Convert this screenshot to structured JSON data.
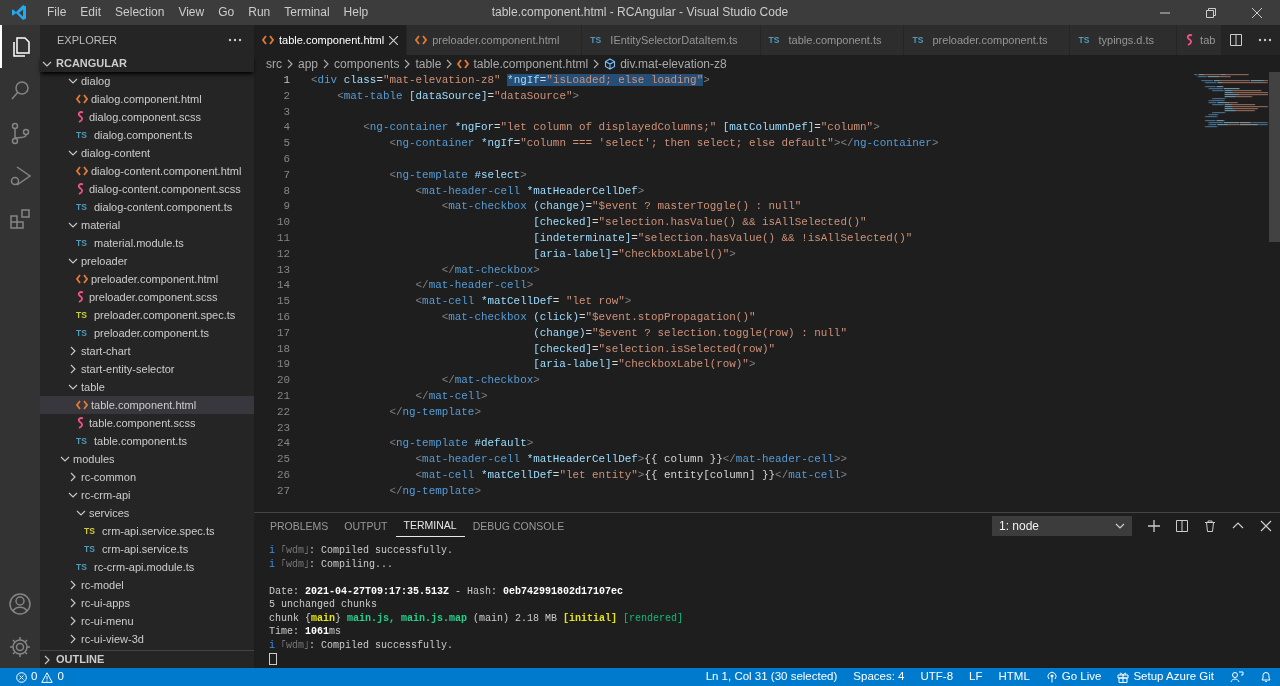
{
  "window": {
    "title": "table.component.html - RCAngular - Visual Studio Code"
  },
  "menu": [
    "File",
    "Edit",
    "Selection",
    "View",
    "Go",
    "Run",
    "Terminal",
    "Help"
  ],
  "explorer": {
    "title": "EXPLORER",
    "root": "RCANGULAR",
    "root_expanded": true,
    "outline": "OUTLINE",
    "outline_expanded": false,
    "tree_top": [
      {
        "name": "dialog",
        "kind": "folder",
        "expanded": true,
        "selected": false,
        "children": [
          {
            "name": "dialog.component.html",
            "kind": "html",
            "selected": false
          },
          {
            "name": "dialog.component.scss",
            "kind": "scss",
            "selected": false
          },
          {
            "name": "dialog.component.ts",
            "kind": "ts",
            "badge": "TS",
            "selected": false
          }
        ]
      },
      {
        "name": "dialog-content",
        "kind": "folder",
        "expanded": true,
        "selected": false,
        "children": [
          {
            "name": "dialog-content.component.html",
            "kind": "html",
            "selected": false
          },
          {
            "name": "dialog-content.component.scss",
            "kind": "scss",
            "selected": false
          },
          {
            "name": "dialog-content.component.ts",
            "kind": "ts",
            "badge": "TS",
            "selected": false
          }
        ]
      },
      {
        "name": "material",
        "kind": "folder",
        "expanded": true,
        "selected": false,
        "children": [
          {
            "name": "material.module.ts",
            "kind": "ts",
            "badge": "TS",
            "selected": false
          }
        ]
      },
      {
        "name": "preloader",
        "kind": "folder",
        "expanded": true,
        "selected": false,
        "children": [
          {
            "name": "preloader.component.html",
            "kind": "html",
            "selected": false
          },
          {
            "name": "preloader.component.scss",
            "kind": "scss",
            "selected": false
          },
          {
            "name": "preloader.component.spec.ts",
            "kind": "spec",
            "badge": "TS",
            "selected": false
          },
          {
            "name": "preloader.component.ts",
            "kind": "ts",
            "badge": "TS",
            "selected": false
          }
        ]
      },
      {
        "name": "start-chart",
        "kind": "folder",
        "expanded": false,
        "selected": false
      },
      {
        "name": "start-entity-selector",
        "kind": "folder",
        "expanded": false,
        "selected": false
      },
      {
        "name": "table",
        "kind": "folder",
        "expanded": true,
        "selected": false,
        "children": [
          {
            "name": "table.component.html",
            "kind": "html",
            "selected": true
          },
          {
            "name": "table.component.scss",
            "kind": "scss",
            "selected": false
          },
          {
            "name": "table.component.ts",
            "kind": "ts",
            "badge": "TS",
            "selected": false
          }
        ]
      }
    ],
    "tree": [
      {
        "name": "modules",
        "kind": "folder",
        "expanded": true,
        "selected": false,
        "children": [
          {
            "name": "rc-common",
            "kind": "folder",
            "expanded": false,
            "selected": false
          },
          {
            "name": "rc-crm-api",
            "kind": "folder",
            "expanded": true,
            "selected": false,
            "children": [
              {
                "name": "services",
                "kind": "folder",
                "expanded": true,
                "selected": false,
                "children": [
                  {
                    "name": "crm-api.service.spec.ts",
                    "kind": "spec",
                    "badge": "TS",
                    "selected": false
                  },
                  {
                    "name": "crm-api.service.ts",
                    "kind": "ts",
                    "badge": "TS",
                    "selected": false
                  }
                ]
              },
              {
                "name": "rc-crm-api.module.ts",
                "kind": "ts",
                "badge": "TS",
                "selected": false
              }
            ]
          },
          {
            "name": "rc-model",
            "kind": "folder",
            "expanded": false,
            "selected": false
          },
          {
            "name": "rc-ui-apps",
            "kind": "folder",
            "expanded": false,
            "selected": false
          },
          {
            "name": "rc-ui-menu",
            "kind": "folder",
            "expanded": false,
            "selected": false
          },
          {
            "name": "rc-ui-view-3d",
            "kind": "folder",
            "expanded": false,
            "selected": false
          }
        ]
      }
    ]
  },
  "tabs": [
    {
      "label": "table.component.html",
      "kind": "html",
      "selected": true
    },
    {
      "label": "preloader.component.html",
      "kind": "html",
      "selected": false
    },
    {
      "label": "IEntitySelectorDataItem.ts",
      "kind": "ts",
      "badge": "TS",
      "selected": false
    },
    {
      "label": "table.component.ts",
      "kind": "ts",
      "badge": "TS",
      "selected": false
    },
    {
      "label": "preloader.component.ts",
      "kind": "ts",
      "badge": "TS",
      "selected": false
    },
    {
      "label": "typings.d.ts",
      "kind": "ts",
      "badge": "TS",
      "selected": false
    },
    {
      "label": "tab",
      "kind": "scss",
      "selected": false
    }
  ],
  "breadcrumbs": [
    {
      "text": "src",
      "kind": "folder"
    },
    {
      "text": "app",
      "kind": "folder"
    },
    {
      "text": "components",
      "kind": "folder"
    },
    {
      "text": "table",
      "kind": "folder"
    },
    {
      "text": "table.component.html",
      "kind": "html"
    },
    {
      "text": "div.mat-elevation-z8",
      "kind": "element"
    }
  ],
  "code": [
    {
      "number": "1",
      "tokens": [
        {
          "kind": "bracket",
          "text": "<"
        },
        {
          "kind": "tag",
          "text": "div"
        },
        {
          "kind": "attr",
          "text": " class"
        },
        {
          "kind": "plain",
          "text": "="
        },
        {
          "kind": "value",
          "text": "\"mat-elevation-z8\" "
        },
        {
          "kind": "attr",
          "text": "*ngIf",
          "selected": true
        },
        {
          "kind": "plain",
          "text": "=",
          "selected": true
        },
        {
          "kind": "value",
          "text": "\"isLoaded; else loading\"",
          "selected": true
        },
        {
          "kind": "bracket",
          "text": ">"
        }
      ]
    },
    {
      "number": "2",
      "tokens": [
        {
          "kind": "bracket",
          "text": "    <"
        },
        {
          "kind": "tag",
          "text": "mat-table"
        },
        {
          "kind": "attr",
          "text": " [dataSource]"
        },
        {
          "kind": "plain",
          "text": "="
        },
        {
          "kind": "value",
          "text": "\"dataSource\""
        },
        {
          "kind": "bracket",
          "text": ">"
        }
      ]
    },
    {
      "number": "3"
    },
    {
      "number": "4",
      "tokens": [
        {
          "kind": "bracket",
          "text": "        <"
        },
        {
          "kind": "tag",
          "text": "ng-container"
        },
        {
          "kind": "attr",
          "text": " *ngFor"
        },
        {
          "kind": "plain",
          "text": "="
        },
        {
          "kind": "value",
          "text": "\"let column of displayedColumns;\""
        },
        {
          "kind": "attr",
          "text": " [matColumnDef]"
        },
        {
          "kind": "plain",
          "text": "="
        },
        {
          "kind": "value",
          "text": "\"column\""
        },
        {
          "kind": "bracket",
          "text": ">"
        }
      ]
    },
    {
      "number": "5",
      "tokens": [
        {
          "kind": "bracket",
          "text": "            <"
        },
        {
          "kind": "tag",
          "text": "ng-container"
        },
        {
          "kind": "attr",
          "text": " *ngIf"
        },
        {
          "kind": "plain",
          "text": "="
        },
        {
          "kind": "value",
          "text": "\"column === 'select'; then select; else default\""
        },
        {
          "kind": "bracket",
          "text": "></"
        },
        {
          "kind": "tag",
          "text": "ng-container"
        },
        {
          "kind": "bracket",
          "text": ">"
        }
      ]
    },
    {
      "number": "6"
    },
    {
      "number": "7",
      "tokens": [
        {
          "kind": "bracket",
          "text": "            <"
        },
        {
          "kind": "tag",
          "text": "ng-template"
        },
        {
          "kind": "attr",
          "text": " #select"
        },
        {
          "kind": "bracket",
          "text": ">"
        }
      ]
    },
    {
      "number": "8",
      "tokens": [
        {
          "kind": "bracket",
          "text": "                <"
        },
        {
          "kind": "tag",
          "text": "mat-header-cell"
        },
        {
          "kind": "attr",
          "text": " *matHeaderCellDef"
        },
        {
          "kind": "bracket",
          "text": ">"
        }
      ]
    },
    {
      "number": "9",
      "tokens": [
        {
          "kind": "bracket",
          "text": "                    <"
        },
        {
          "kind": "tag",
          "text": "mat-checkbox"
        },
        {
          "kind": "attr",
          "text": " (change)"
        },
        {
          "kind": "plain",
          "text": "="
        },
        {
          "kind": "value",
          "text": "\"$event ? masterToggle() : null\""
        }
      ]
    },
    {
      "number": "10",
      "tokens": [
        {
          "kind": "attr",
          "text": "                                  [checked]"
        },
        {
          "kind": "plain",
          "text": "="
        },
        {
          "kind": "value",
          "text": "\"selection.hasValue() && isAllSelected()\""
        }
      ]
    },
    {
      "number": "11",
      "tokens": [
        {
          "kind": "attr",
          "text": "                                  [indeterminate]"
        },
        {
          "kind": "plain",
          "text": "="
        },
        {
          "kind": "value",
          "text": "\"selection.hasValue() && !isAllSelected()\""
        }
      ]
    },
    {
      "number": "12",
      "tokens": [
        {
          "kind": "attr",
          "text": "                                  [aria-label]"
        },
        {
          "kind": "plain",
          "text": "="
        },
        {
          "kind": "value",
          "text": "\"checkboxLabel()\""
        },
        {
          "kind": "bracket",
          "text": ">"
        }
      ]
    },
    {
      "number": "13",
      "tokens": [
        {
          "kind": "bracket",
          "text": "                    </"
        },
        {
          "kind": "tag",
          "text": "mat-checkbox"
        },
        {
          "kind": "bracket",
          "text": ">"
        }
      ]
    },
    {
      "number": "14",
      "tokens": [
        {
          "kind": "bracket",
          "text": "                </"
        },
        {
          "kind": "tag",
          "text": "mat-header-cell"
        },
        {
          "kind": "bracket",
          "text": ">"
        }
      ]
    },
    {
      "number": "15",
      "tokens": [
        {
          "kind": "bracket",
          "text": "                <"
        },
        {
          "kind": "tag",
          "text": "mat-cell"
        },
        {
          "kind": "attr",
          "text": " *matCellDef"
        },
        {
          "kind": "plain",
          "text": "= "
        },
        {
          "kind": "value",
          "text": "\"let row\""
        },
        {
          "kind": "bracket",
          "text": ">"
        }
      ]
    },
    {
      "number": "16",
      "tokens": [
        {
          "kind": "bracket",
          "text": "                    <"
        },
        {
          "kind": "tag",
          "text": "mat-checkbox"
        },
        {
          "kind": "attr",
          "text": " (click)"
        },
        {
          "kind": "plain",
          "text": "="
        },
        {
          "kind": "value",
          "text": "\"$event.stopPropagation()\""
        }
      ]
    },
    {
      "number": "17",
      "tokens": [
        {
          "kind": "attr",
          "text": "                                  (change)"
        },
        {
          "kind": "plain",
          "text": "="
        },
        {
          "kind": "value",
          "text": "\"$event ? selection.toggle(row) : null\""
        }
      ]
    },
    {
      "number": "18",
      "tokens": [
        {
          "kind": "attr",
          "text": "                                  [checked]"
        },
        {
          "kind": "plain",
          "text": "="
        },
        {
          "kind": "value",
          "text": "\"selection.isSelected(row)\""
        }
      ]
    },
    {
      "number": "19",
      "tokens": [
        {
          "kind": "attr",
          "text": "                                  [aria-label]"
        },
        {
          "kind": "plain",
          "text": "="
        },
        {
          "kind": "value",
          "text": "\"checkboxLabel(row)\""
        },
        {
          "kind": "bracket",
          "text": ">"
        }
      ]
    },
    {
      "number": "20",
      "tokens": [
        {
          "kind": "bracket",
          "text": "                    </"
        },
        {
          "kind": "tag",
          "text": "mat-checkbox"
        },
        {
          "kind": "bracket",
          "text": ">"
        }
      ]
    },
    {
      "number": "21",
      "tokens": [
        {
          "kind": "bracket",
          "text": "                </"
        },
        {
          "kind": "tag",
          "text": "mat-cell"
        },
        {
          "kind": "bracket",
          "text": ">"
        }
      ]
    },
    {
      "number": "22",
      "tokens": [
        {
          "kind": "bracket",
          "text": "            </"
        },
        {
          "kind": "tag",
          "text": "ng-template"
        },
        {
          "kind": "bracket",
          "text": ">"
        }
      ]
    },
    {
      "number": "23"
    },
    {
      "number": "24",
      "tokens": [
        {
          "kind": "bracket",
          "text": "            <"
        },
        {
          "kind": "tag",
          "text": "ng-template"
        },
        {
          "kind": "attr",
          "text": " #default"
        },
        {
          "kind": "bracket",
          "text": ">"
        }
      ]
    },
    {
      "number": "25",
      "tokens": [
        {
          "kind": "bracket",
          "text": "                <"
        },
        {
          "kind": "tag",
          "text": "mat-header-cell"
        },
        {
          "kind": "attr",
          "text": " *matHeaderCellDef"
        },
        {
          "kind": "bracket",
          "text": ">"
        },
        {
          "kind": "plain",
          "text": "{{ column }}"
        },
        {
          "kind": "bracket",
          "text": "</"
        },
        {
          "kind": "tag",
          "text": "mat-header-cell"
        },
        {
          "kind": "bracket",
          "text": ">>"
        }
      ]
    },
    {
      "number": "26",
      "tokens": [
        {
          "kind": "bracket",
          "text": "                <"
        },
        {
          "kind": "tag",
          "text": "mat-cell"
        },
        {
          "kind": "attr",
          "text": " *matCellDef"
        },
        {
          "kind": "plain",
          "text": "="
        },
        {
          "kind": "value",
          "text": "\"let entity\""
        },
        {
          "kind": "bracket",
          "text": ">"
        },
        {
          "kind": "plain",
          "text": "{{ entity[column] }}"
        },
        {
          "kind": "bracket",
          "text": "</"
        },
        {
          "kind": "tag",
          "text": "mat-cell"
        },
        {
          "kind": "bracket",
          "text": ">"
        }
      ]
    },
    {
      "number": "27",
      "tokens": [
        {
          "kind": "bracket",
          "text": "            </"
        },
        {
          "kind": "tag",
          "text": "ng-template"
        },
        {
          "kind": "bracket",
          "text": ">"
        }
      ]
    }
  ],
  "panel": {
    "tabs": [
      {
        "label": "PROBLEMS",
        "selected": false
      },
      {
        "label": "OUTPUT",
        "selected": false
      },
      {
        "label": "TERMINAL",
        "selected": true
      },
      {
        "label": "DEBUG CONSOLE",
        "selected": false
      }
    ],
    "terminal_select": "1: node",
    "terminal": [
      {
        "segments": [
          {
            "kind": "info",
            "text": "i"
          },
          {
            "kind": "dim",
            "text": " ｢wdm｣"
          },
          {
            "kind": "plain",
            "text": ": Compiled successfully."
          }
        ]
      },
      {
        "segments": [
          {
            "kind": "info",
            "text": "i"
          },
          {
            "kind": "dim",
            "text": " ｢wdm｣"
          },
          {
            "kind": "plain",
            "text": ": Compiling..."
          }
        ]
      },
      {
        "kind": "blank"
      },
      {
        "segments": [
          {
            "kind": "plain",
            "text": "Date: "
          },
          {
            "kind": "bold",
            "text": "2021-04-27T09:17:35.513Z"
          },
          {
            "kind": "plain",
            "text": " - Hash: "
          },
          {
            "kind": "bold",
            "text": "0eb742991802d17107ec"
          }
        ]
      },
      {
        "segments": [
          {
            "kind": "plain",
            "text": "5 unchanged chunks"
          }
        ]
      },
      {
        "segments": [
          {
            "kind": "plain",
            "text": "chunk {"
          },
          {
            "kind": "yellow",
            "text": "main"
          },
          {
            "kind": "plain",
            "text": "} "
          },
          {
            "kind": "green",
            "text": "main.js, main.js.map"
          },
          {
            "kind": "plain",
            "text": " (main) 2.18 MB "
          },
          {
            "kind": "yellow",
            "text": "[initial]"
          },
          {
            "kind": "green-plain",
            "text": " [rendered]"
          }
        ]
      },
      {
        "segments": [
          {
            "kind": "plain",
            "text": "Time: "
          },
          {
            "kind": "bold",
            "text": "1061"
          },
          {
            "kind": "plain",
            "text": "ms"
          }
        ]
      },
      {
        "segments": [
          {
            "kind": "info",
            "text": "i"
          },
          {
            "kind": "dim",
            "text": " ｢wdm｣"
          },
          {
            "kind": "plain",
            "text": ": Compiled successfully."
          }
        ]
      }
    ]
  },
  "status_bar": {
    "errors": "0",
    "warnings": "0",
    "items": [
      {
        "kind": "text",
        "text": "Ln 1, Col 31 (30 selected)"
      },
      {
        "kind": "text",
        "text": "Spaces: 4"
      },
      {
        "kind": "text",
        "text": "UTF-8"
      },
      {
        "kind": "text",
        "text": "LF"
      },
      {
        "kind": "text",
        "text": "HTML"
      },
      {
        "kind": "golive",
        "text": "Go Live"
      },
      {
        "kind": "azure",
        "text": "Setup Azure Git"
      },
      {
        "kind": "feedback"
      },
      {
        "kind": "bell"
      }
    ]
  }
}
